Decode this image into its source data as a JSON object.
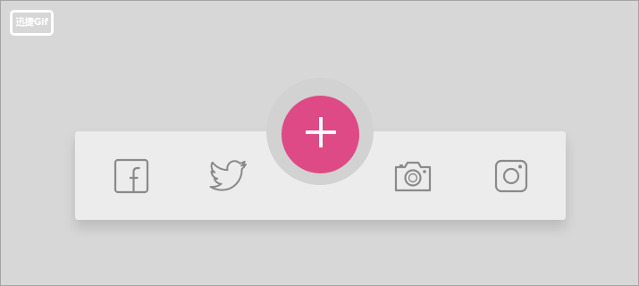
{
  "watermark": {
    "text": "迅捷Gif"
  },
  "menu": {
    "items": [
      {
        "name": "facebook",
        "icon": "facebook-icon"
      },
      {
        "name": "twitter",
        "icon": "twitter-icon"
      },
      {
        "name": "camera",
        "icon": "camera-icon"
      },
      {
        "name": "instagram",
        "icon": "instagram-icon"
      }
    ],
    "fab": {
      "icon": "plus-icon"
    }
  },
  "colors": {
    "background": "#d7d7d7",
    "menu_bar": "#ececec",
    "fab_accent": "#de4a85",
    "icon": "#8a8a8a"
  }
}
